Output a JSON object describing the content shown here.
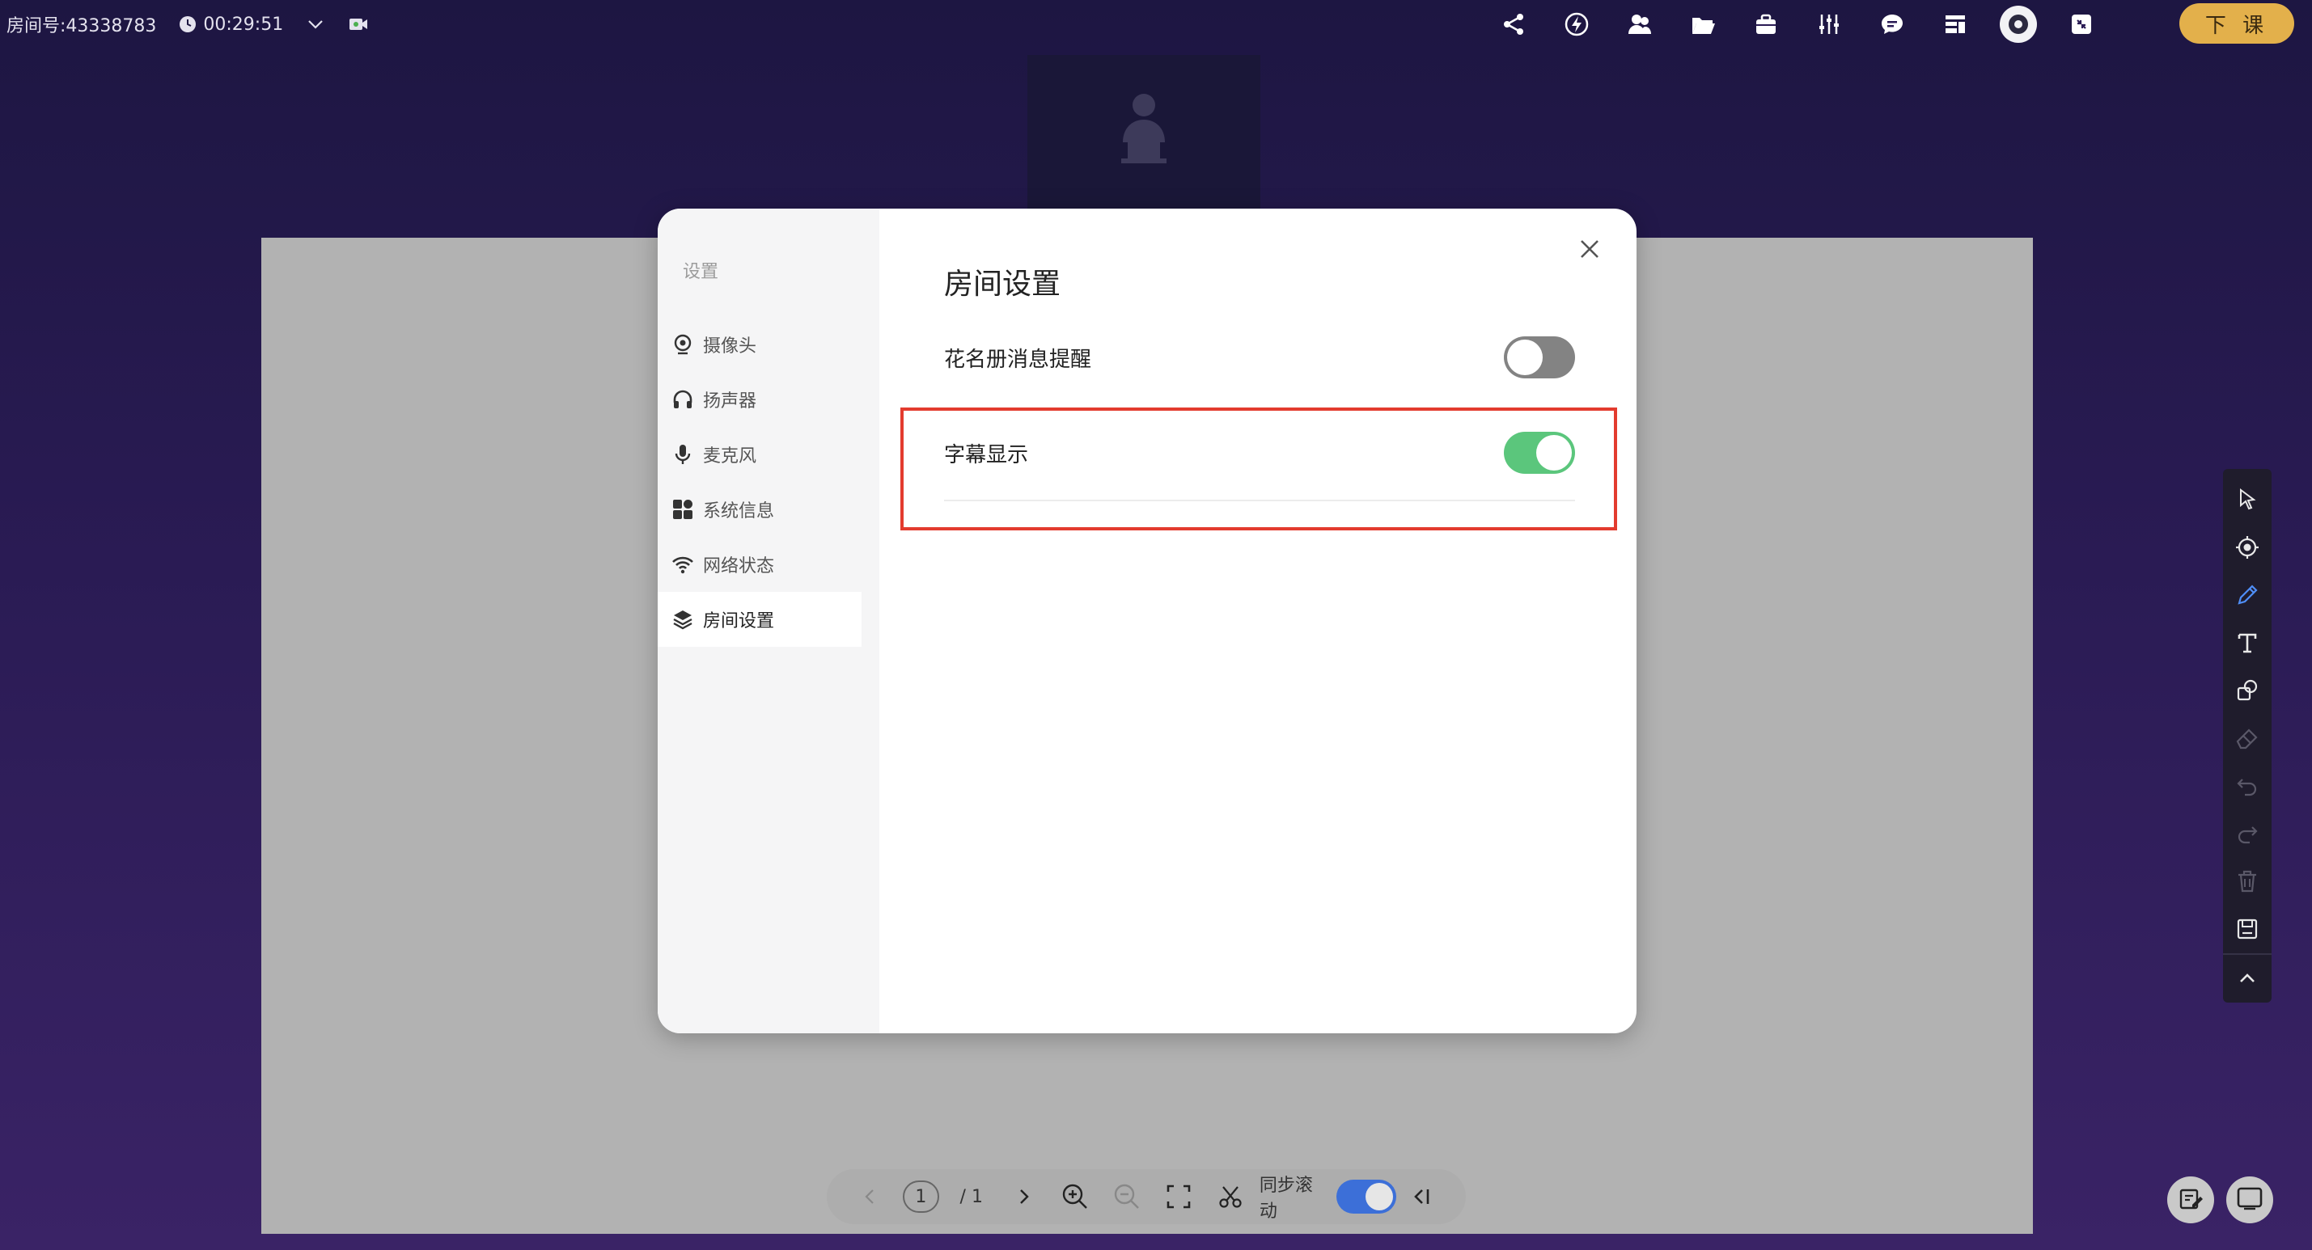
{
  "header": {
    "room_label": "房间号:43338783",
    "timer": "00:29:51",
    "end_class_label": "下 课",
    "toolbar_icons": [
      "share-icon",
      "lightning-icon",
      "users-icon",
      "folder-icon",
      "toolbox-icon",
      "equalizer-icon",
      "chat-icon",
      "layout-icon",
      "settings-icon",
      "exit-fullscreen-icon"
    ]
  },
  "settings_modal": {
    "sidebar_title": "设置",
    "sidebar_items": [
      {
        "label": "摄像头",
        "icon": "camera-icon"
      },
      {
        "label": "扬声器",
        "icon": "headphones-icon"
      },
      {
        "label": "麦克风",
        "icon": "microphone-icon"
      },
      {
        "label": "系统信息",
        "icon": "grid-icon"
      },
      {
        "label": "网络状态",
        "icon": "wifi-icon"
      },
      {
        "label": "房间设置",
        "icon": "layers-icon",
        "active": true
      }
    ],
    "title": "房间设置",
    "settings": [
      {
        "label": "花名册消息提醒",
        "enabled": false
      },
      {
        "label": "字幕显示",
        "enabled": true
      }
    ]
  },
  "page_controls": {
    "current_page": "1",
    "total_pages": "/ 1",
    "sync_scroll_label": "同步滚动",
    "sync_scroll_enabled": true
  },
  "tool_rail": {
    "tools": [
      "pointer-icon",
      "laser-icon",
      "pen-icon",
      "text-icon",
      "shapes-icon",
      "eraser-icon",
      "undo-icon",
      "redo-icon",
      "trash-icon",
      "save-icon",
      "collapse-icon"
    ],
    "active_tool": "pen-icon"
  },
  "colors": {
    "accent_green": "#5bc67c",
    "accent_blue": "#3c6fd8",
    "end_button": "#e3b04b",
    "highlight_red": "#e33b2e"
  }
}
